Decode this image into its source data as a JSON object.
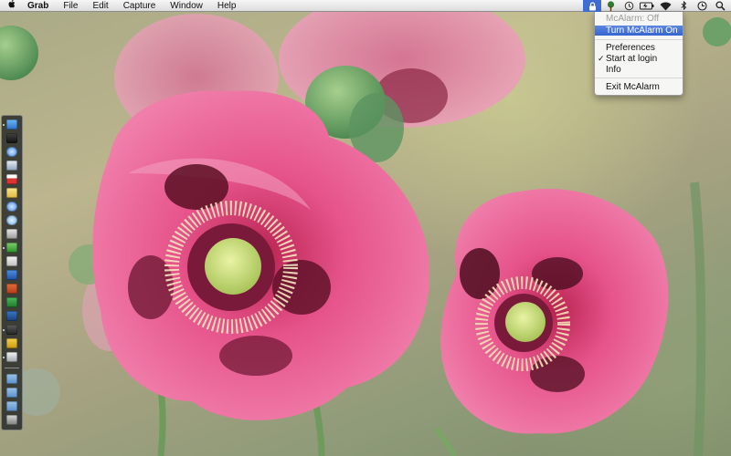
{
  "menubar": {
    "apple_icon": "apple-logo-icon",
    "app_name": "Grab",
    "menus": [
      "File",
      "Edit",
      "Capture",
      "Window",
      "Help"
    ],
    "status_icons": [
      "mcalarm-lock-icon",
      "tree-icon",
      "time-machine-icon",
      "battery-icon",
      "wifi-icon",
      "bluetooth-icon",
      "clock-icon",
      "spotlight-icon"
    ]
  },
  "mcalarm_menu": {
    "status": "McAlarm: Off",
    "toggle": "Turn McAlarm On",
    "preferences": "Preferences",
    "start_at_login": "Start at login",
    "start_at_login_checked": true,
    "info": "Info",
    "exit": "Exit McAlarm"
  },
  "colors": {
    "highlight": "#3d6cd3",
    "poppy_pink": "#e0588a",
    "poppy_center": "#c7db7a"
  },
  "dock": {
    "orientation": "left",
    "icons": [
      "finder-icon",
      "dashboard-icon",
      "safari-icon",
      "mail-icon",
      "calendar-icon",
      "notes-icon",
      "itunes-icon",
      "preview-icon",
      "terminal-icon",
      "photo-icon",
      "xcode-icon",
      "word-icon",
      "powerpoint-icon",
      "excel-icon",
      "system-prefs-icon",
      "facetime-icon",
      "keychain-icon",
      "textedit-icon",
      "applications-folder-icon",
      "documents-folder-icon",
      "downloads-folder-icon",
      "trash-icon"
    ]
  }
}
